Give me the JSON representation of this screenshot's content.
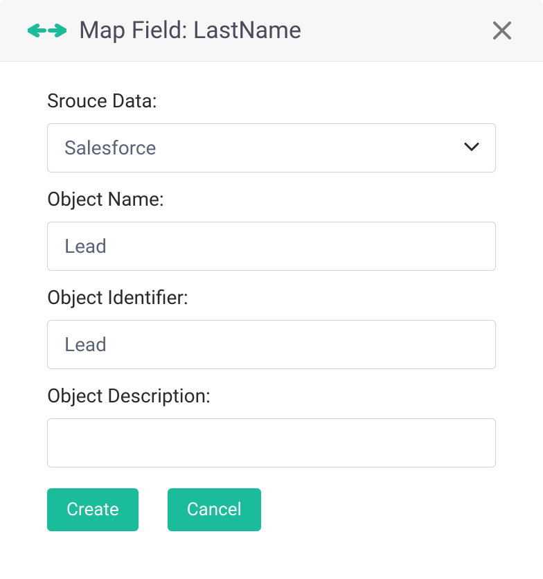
{
  "header": {
    "title": "Map Field: LastName"
  },
  "form": {
    "sourceData": {
      "label": "Srouce Data:",
      "value": "Salesforce"
    },
    "objectName": {
      "label": "Object Name:",
      "value": "Lead"
    },
    "objectIdentifier": {
      "label": "Object Identifier:",
      "value": "Lead"
    },
    "objectDescription": {
      "label": "Object Description:",
      "value": ""
    }
  },
  "buttons": {
    "create": "Create",
    "cancel": "Cancel"
  },
  "colors": {
    "accent": "#1abc9c",
    "text": "#2a2a2a",
    "muted": "#5a6478",
    "border": "#d0d4da"
  }
}
